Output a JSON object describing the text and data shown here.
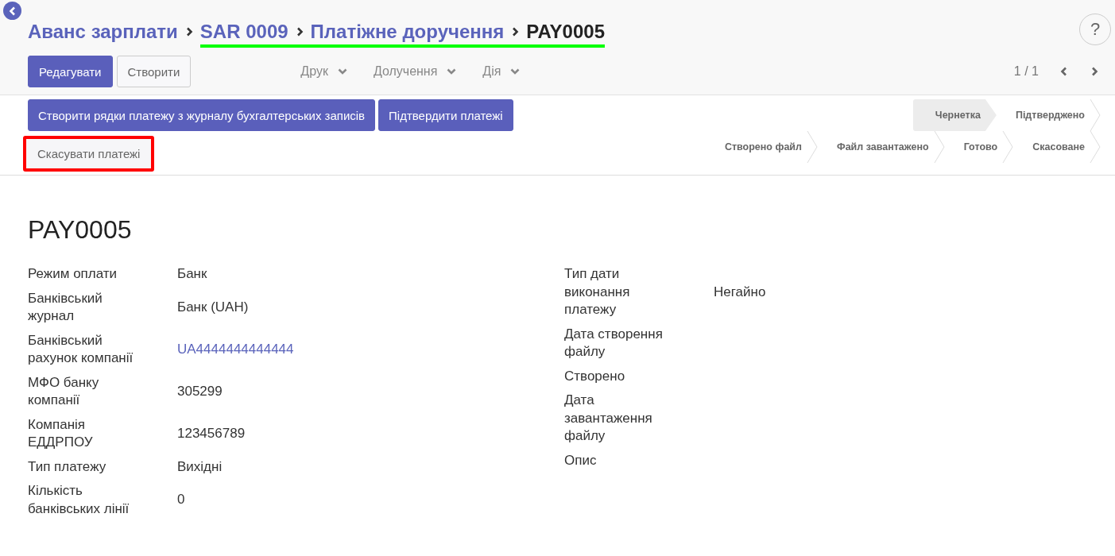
{
  "breadcrumb": [
    {
      "label": "Аванс зарплати",
      "kind": "link",
      "marked": false
    },
    {
      "label": "SAR 0009",
      "kind": "link",
      "marked": true
    },
    {
      "label": "Платіжне доручення",
      "kind": "link",
      "marked": true
    },
    {
      "label": "PAY0005",
      "kind": "current",
      "marked": true
    }
  ],
  "help": {
    "label": "?"
  },
  "main_buttons": [
    {
      "label": "Редагувати",
      "kind": "primary"
    },
    {
      "label": "Створити",
      "kind": "secondary"
    }
  ],
  "menus": [
    "Друк",
    "Долучення",
    "Дія"
  ],
  "pager": {
    "label": "1 / 1"
  },
  "action_buttons": [
    {
      "label": "Створити рядки платежу з журналу бухгалтерських записів",
      "kind": "primary",
      "marked": false
    },
    {
      "label": "Підтвердити платежі",
      "kind": "primary",
      "marked": false
    },
    {
      "label": "Скасувати платежі",
      "kind": "secondary",
      "marked": true
    }
  ],
  "stages": [
    {
      "label": "Чернетка",
      "selected": true
    },
    {
      "label": "Підтверджено",
      "selected": false
    },
    {
      "label": "Створено файл",
      "selected": false
    },
    {
      "label": "Файл завантажено",
      "selected": false
    },
    {
      "label": "Готово",
      "selected": false
    },
    {
      "label": "Скасоване",
      "selected": false
    }
  ],
  "title": "PAY0005",
  "left_fields": [
    {
      "label": "Режим оплати",
      "value": "Банк",
      "kind": "text"
    },
    {
      "label": "Банківський журнал",
      "value": "Банк (UAH)",
      "kind": "text"
    },
    {
      "label": "Банківський рахунок компанії",
      "value": "UA4444444444444",
      "kind": "link"
    },
    {
      "label": "МФО банку компанії",
      "value": "305299",
      "kind": "text"
    },
    {
      "label": "Компанія ЕДДРПОУ",
      "value": "123456789",
      "kind": "text"
    },
    {
      "label": "Тип платежу",
      "value": "Вихідні",
      "kind": "text"
    },
    {
      "label": "Кількість банківських лінії",
      "value": "0",
      "kind": "text"
    }
  ],
  "right_fields": [
    {
      "label": "Тип дати виконання платежу",
      "value": "Негайно",
      "kind": "text"
    },
    {
      "label": "Дата створення файлу",
      "kind": "empty"
    },
    {
      "label": "Створено",
      "kind": "empty"
    },
    {
      "label": "Дата завантаження файлу",
      "kind": "empty"
    },
    {
      "label": "Опис",
      "kind": "empty"
    }
  ]
}
